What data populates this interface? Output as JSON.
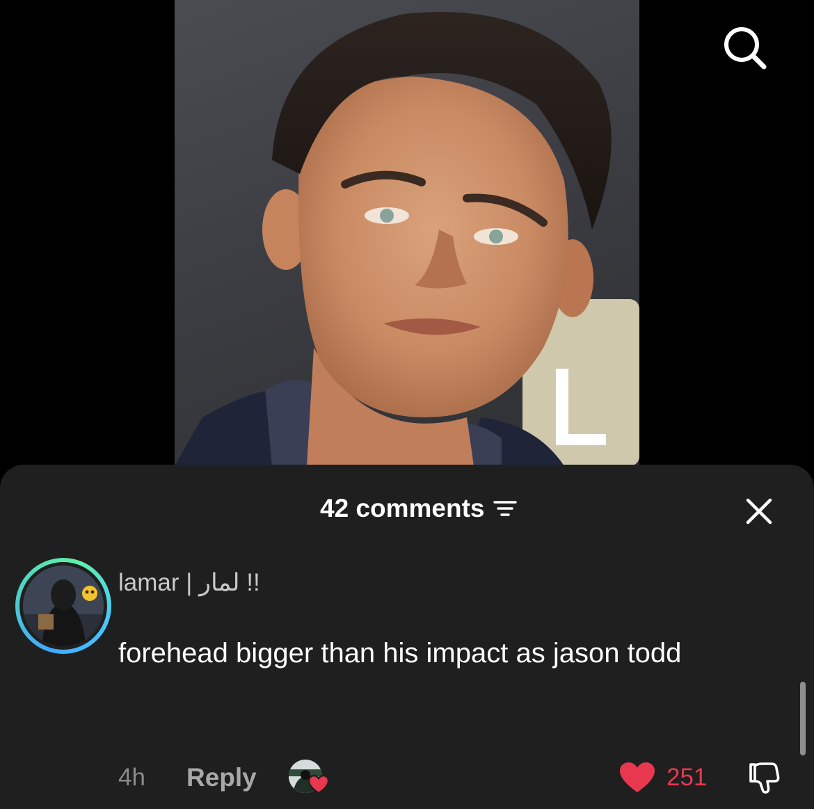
{
  "video": {
    "image_alt": "close-up portrait of a young man with swept-back dark hair"
  },
  "search": {
    "icon": "search-icon"
  },
  "comments_sheet": {
    "count_label": "42 comments",
    "sort_icon": "filter-icon",
    "close_icon": "close-icon"
  },
  "comment": {
    "username": "lamar | لمار !!",
    "text": "forehead bigger than his impact as jason todd",
    "time": "4h",
    "reply_label": "Reply",
    "like_count": "251",
    "like_icon": "heart-icon",
    "dislike_icon": "thumbs-down-icon",
    "creator_liked": true
  },
  "colors": {
    "sheet_background": "#1f1f1f",
    "like_red": "#e8384f",
    "avatar_ring_start": "#3fa9ff",
    "avatar_ring_end": "#5ff2a8"
  }
}
